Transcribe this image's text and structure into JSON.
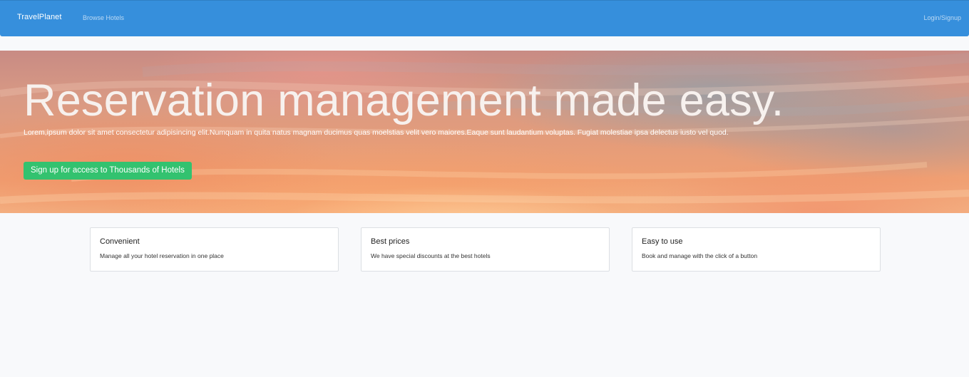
{
  "navbar": {
    "brand": "TravelPlanet",
    "browse_label": "Browse Hotels",
    "login_label": "Login/Signup"
  },
  "hero": {
    "title": "Reservation management made easy.",
    "text": "Lorem,ipsum dolor sit amet consectetur adipisincing elit.Numquam in quita natus magnam ducimus quas moelstias velit vero maiores.Eaque sunt laudantium voluptas. Fugiat molestiae ipsa delectus iusto vel quod.",
    "cta_label": "Sign up for access to Thousands of Hotels"
  },
  "features": [
    {
      "title": "Convenient",
      "text": "Manage all your hotel reservation in one place"
    },
    {
      "title": "Best prices",
      "text": "We have special discounts at the best hotels"
    },
    {
      "title": "Easy to use",
      "text": "Book and manage with the click of a button"
    }
  ],
  "colors": {
    "navbar_bg": "#368fdc",
    "cta_bg": "#33c26f",
    "page_bg": "#f8f9fb"
  }
}
